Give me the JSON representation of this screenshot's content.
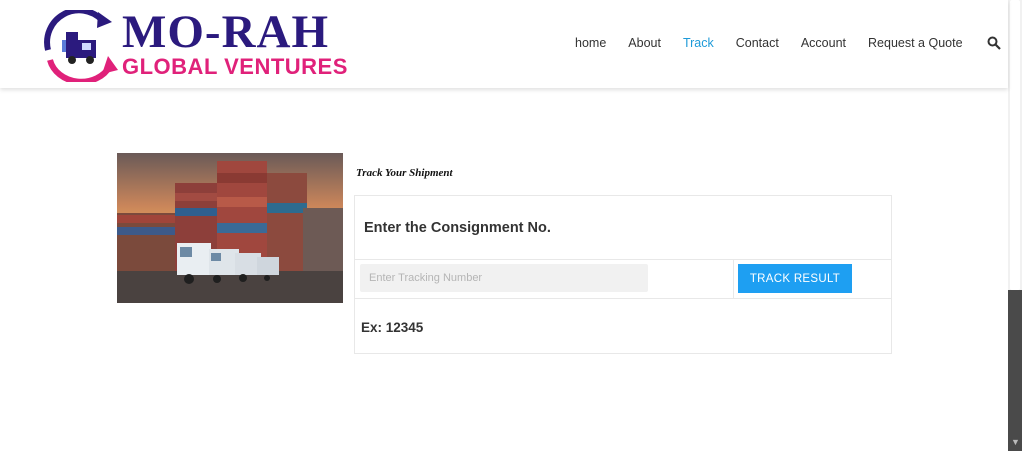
{
  "brand": {
    "name": "MO-RAH",
    "tagline": "GLOBAL VENTURES",
    "colors": {
      "primary": "#2b1a7e",
      "accent": "#e0217a"
    }
  },
  "nav": {
    "items": [
      {
        "label": "home"
      },
      {
        "label": "About"
      },
      {
        "label": "Track",
        "active": true
      },
      {
        "label": "Contact"
      },
      {
        "label": "Account"
      },
      {
        "label": "Request a Quote"
      }
    ],
    "search_icon": "search-icon",
    "active_color": "#1e9ad8"
  },
  "hero": {
    "description_icon": "container-trucks-photo"
  },
  "tracking": {
    "title": "Track Your Shipment",
    "heading": "Enter the Consignment No.",
    "input_placeholder": "Enter Tracking Number",
    "input_value": "",
    "button_label": "TRACK RESULT",
    "example": "Ex: 12345",
    "button_color": "#1e9ff2"
  }
}
